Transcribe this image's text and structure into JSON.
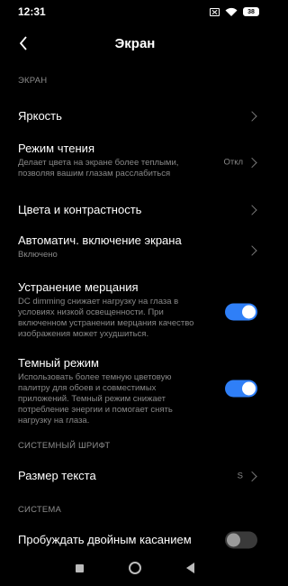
{
  "status": {
    "time": "12:31",
    "battery": "38"
  },
  "header": {
    "title": "Экран"
  },
  "sections": {
    "screen": "ЭКРАН",
    "font": "СИСТЕМНЫЙ ШРИФТ",
    "system": "СИСТЕМА"
  },
  "rows": {
    "brightness": {
      "title": "Яркость"
    },
    "reading": {
      "title": "Режим чтения",
      "subtitle": "Делает цвета на экране более теплыми, позволяя вашим глазам расслабиться",
      "value": "Откл"
    },
    "colors": {
      "title": "Цвета и контрастность"
    },
    "autowake": {
      "title": "Автоматич. включение экрана",
      "subtitle": "Включено"
    },
    "flicker": {
      "title": "Устранение мерцания",
      "subtitle": "DC dimming снижает нагрузку на глаза в условиях низкой освещенности. При включенном устранении мерцания качество изображения может ухудшиться.",
      "enabled": true
    },
    "dark": {
      "title": "Темный режим",
      "subtitle": "Использовать более темную цветовую палитру для обоев и совместимых приложений. Темный режим снижает потребление энергии и помогает снять нагрузку на глаза.",
      "enabled": true
    },
    "textsize": {
      "title": "Размер текста",
      "value": "S"
    },
    "doubletap": {
      "title": "Пробуждать двойным касанием",
      "enabled": false
    }
  },
  "colors": {
    "accent": "#2f7ff7",
    "background": "#000000"
  }
}
